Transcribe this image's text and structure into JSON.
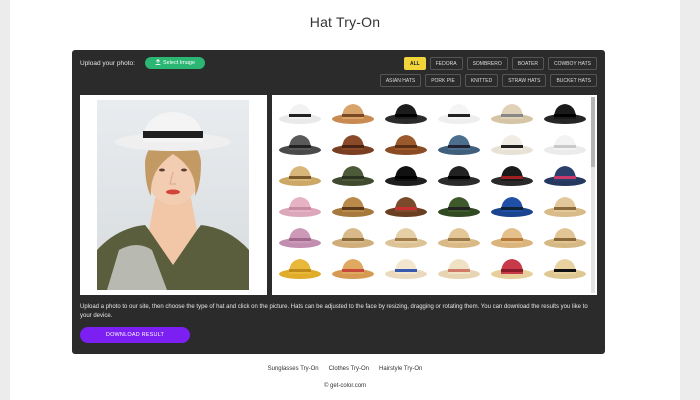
{
  "page": {
    "title": "Hat Try-On"
  },
  "upload": {
    "label": "Upload your photo:",
    "button_label": "Select Image",
    "button_icon": "upload-icon"
  },
  "filters": {
    "row1": [
      {
        "label": "ALL",
        "active": true
      },
      {
        "label": "FEDORA",
        "active": false
      },
      {
        "label": "SOMBRERO",
        "active": false
      },
      {
        "label": "BOATER",
        "active": false
      },
      {
        "label": "COWBOY HATS",
        "active": false
      }
    ],
    "row2": [
      {
        "label": "ASIAN HATS",
        "active": false
      },
      {
        "label": "PORK PIE",
        "active": false
      },
      {
        "label": "KNITTED",
        "active": false
      },
      {
        "label": "STRAW HATS",
        "active": false
      },
      {
        "label": "BUCKET HATS",
        "active": false
      }
    ]
  },
  "hats": [
    {
      "name": "white-fedora",
      "crown": "#f2f2f2",
      "brim": "#e9e9e9",
      "band": "#222"
    },
    {
      "name": "tan-fedora",
      "crown": "#d9a36c",
      "brim": "#c98a52",
      "band": "#7b4a24"
    },
    {
      "name": "black-fedora",
      "crown": "#1c1c1c",
      "brim": "#2b2b2b",
      "band": "#000"
    },
    {
      "name": "white-panama",
      "crown": "#f5f5f5",
      "brim": "#eeeeee",
      "band": "#222"
    },
    {
      "name": "straw-boater",
      "crown": "#e0d2b8",
      "brim": "#d6c5a5",
      "band": "#888"
    },
    {
      "name": "black-porkpie",
      "crown": "#1a1a1a",
      "brim": "#262626",
      "band": "#000"
    },
    {
      "name": "gray-fedora",
      "crown": "#5a5a5a",
      "brim": "#4a4a4a",
      "band": "#222"
    },
    {
      "name": "brown-cowboy",
      "crown": "#8a4a2a",
      "brim": "#7a3e22",
      "band": "#4a2412"
    },
    {
      "name": "brown-trilby",
      "crown": "#9c5a2c",
      "brim": "#8a4c22",
      "band": "#5a2e12"
    },
    {
      "name": "blue-trilby",
      "crown": "#4d6f8e",
      "brim": "#3f5f7c",
      "band": "#223"
    },
    {
      "name": "white-cream-fedora",
      "crown": "#f1ede4",
      "brim": "#e8e2d6",
      "band": "#222"
    },
    {
      "name": "white-ribbon-hat",
      "crown": "#f3f3f3",
      "brim": "#ebebeb",
      "band": "#c9c9c9"
    },
    {
      "name": "straw-cowboy",
      "crown": "#d9b67a",
      "brim": "#cda766",
      "band": "#7a5a2a"
    },
    {
      "name": "army-boonie",
      "crown": "#4d5a3a",
      "brim": "#3f4a2f",
      "band": "#2a3220"
    },
    {
      "name": "black-top-hat",
      "crown": "#111",
      "brim": "#1f1f1f",
      "band": "#000"
    },
    {
      "name": "black-stovepipe",
      "crown": "#222",
      "brim": "#2c2c2c",
      "band": "#000"
    },
    {
      "name": "striped-fedora",
      "crown": "#1a1a1a",
      "brim": "#2a2a2a",
      "band": "#a02020"
    },
    {
      "name": "navy-flower-hat",
      "crown": "#2b3f6b",
      "brim": "#243860",
      "band": "#c63a6b"
    },
    {
      "name": "pink-wide-hat",
      "crown": "#e5b3c4",
      "brim": "#dca7ba",
      "band": "#c88aa0"
    },
    {
      "name": "leopard-hat",
      "crown": "#b98a4a",
      "brim": "#a67a3c",
      "band": "#5a3a1a"
    },
    {
      "name": "red-band-straw",
      "crown": "#7a4a2a",
      "brim": "#6a3e20",
      "band": "#c63030"
    },
    {
      "name": "green-fedora",
      "crown": "#3e5a2a",
      "brim": "#324a22",
      "band": "#222"
    },
    {
      "name": "royal-blue-hat",
      "crown": "#1f4fa6",
      "brim": "#1a4390",
      "band": "#123"
    },
    {
      "name": "natural-straw",
      "crown": "#e2c89a",
      "brim": "#d8bb88",
      "band": "#8a6a3a"
    },
    {
      "name": "lilac-floppy",
      "crown": "#cc9ab8",
      "brim": "#c28eaf",
      "band": "#a0688a"
    },
    {
      "name": "tan-sun-hat",
      "crown": "#d9b98a",
      "brim": "#cfae7c",
      "band": "#8a6a3a"
    },
    {
      "name": "beige-boater",
      "crown": "#e6cfa6",
      "brim": "#dcc396",
      "band": "#a27c4a"
    },
    {
      "name": "flower-straw",
      "crown": "#e3c796",
      "brim": "#d9ba86",
      "band": "#9a7a4a"
    },
    {
      "name": "wide-straw",
      "crown": "#e4c08c",
      "brim": "#dab47c",
      "band": "#b87a3a"
    },
    {
      "name": "beige-cowboy",
      "crown": "#e2c594",
      "brim": "#d6b884",
      "band": "#8a6a3a"
    },
    {
      "name": "yellow-sun-hat",
      "crown": "#e8b83a",
      "brim": "#e0ac2a",
      "band": "#c08a1a"
    },
    {
      "name": "floral-wide-hat",
      "crown": "#e0a860",
      "brim": "#d69a52",
      "band": "#c84a3a"
    },
    {
      "name": "blue-ribbon-boater",
      "crown": "#f2e6cf",
      "brim": "#ead9bd",
      "band": "#3a5ab0"
    },
    {
      "name": "cream-flower-hat",
      "crown": "#efe1c4",
      "brim": "#e6d4b2",
      "band": "#d07a6a"
    },
    {
      "name": "red-floral-hat",
      "crown": "#c83a4a",
      "brim": "#e6cf9a",
      "band": "#8a1a2a"
    },
    {
      "name": "black-band-boater",
      "crown": "#e8d2a0",
      "brim": "#dfc792",
      "band": "#111"
    }
  ],
  "description": "Upload a photo to our site, then choose the type of hat and click on the picture. Hats can be adjusted to the face by resizing, dragging or rotating them. You can download the results you like to your device.",
  "download": {
    "label": "DOWNLOAD RESULT"
  },
  "footer": {
    "links": [
      "Sunglasses Try-On",
      "Clothes Try-On",
      "Hairstyle Try-On"
    ],
    "copyright": "© get-color.com"
  }
}
